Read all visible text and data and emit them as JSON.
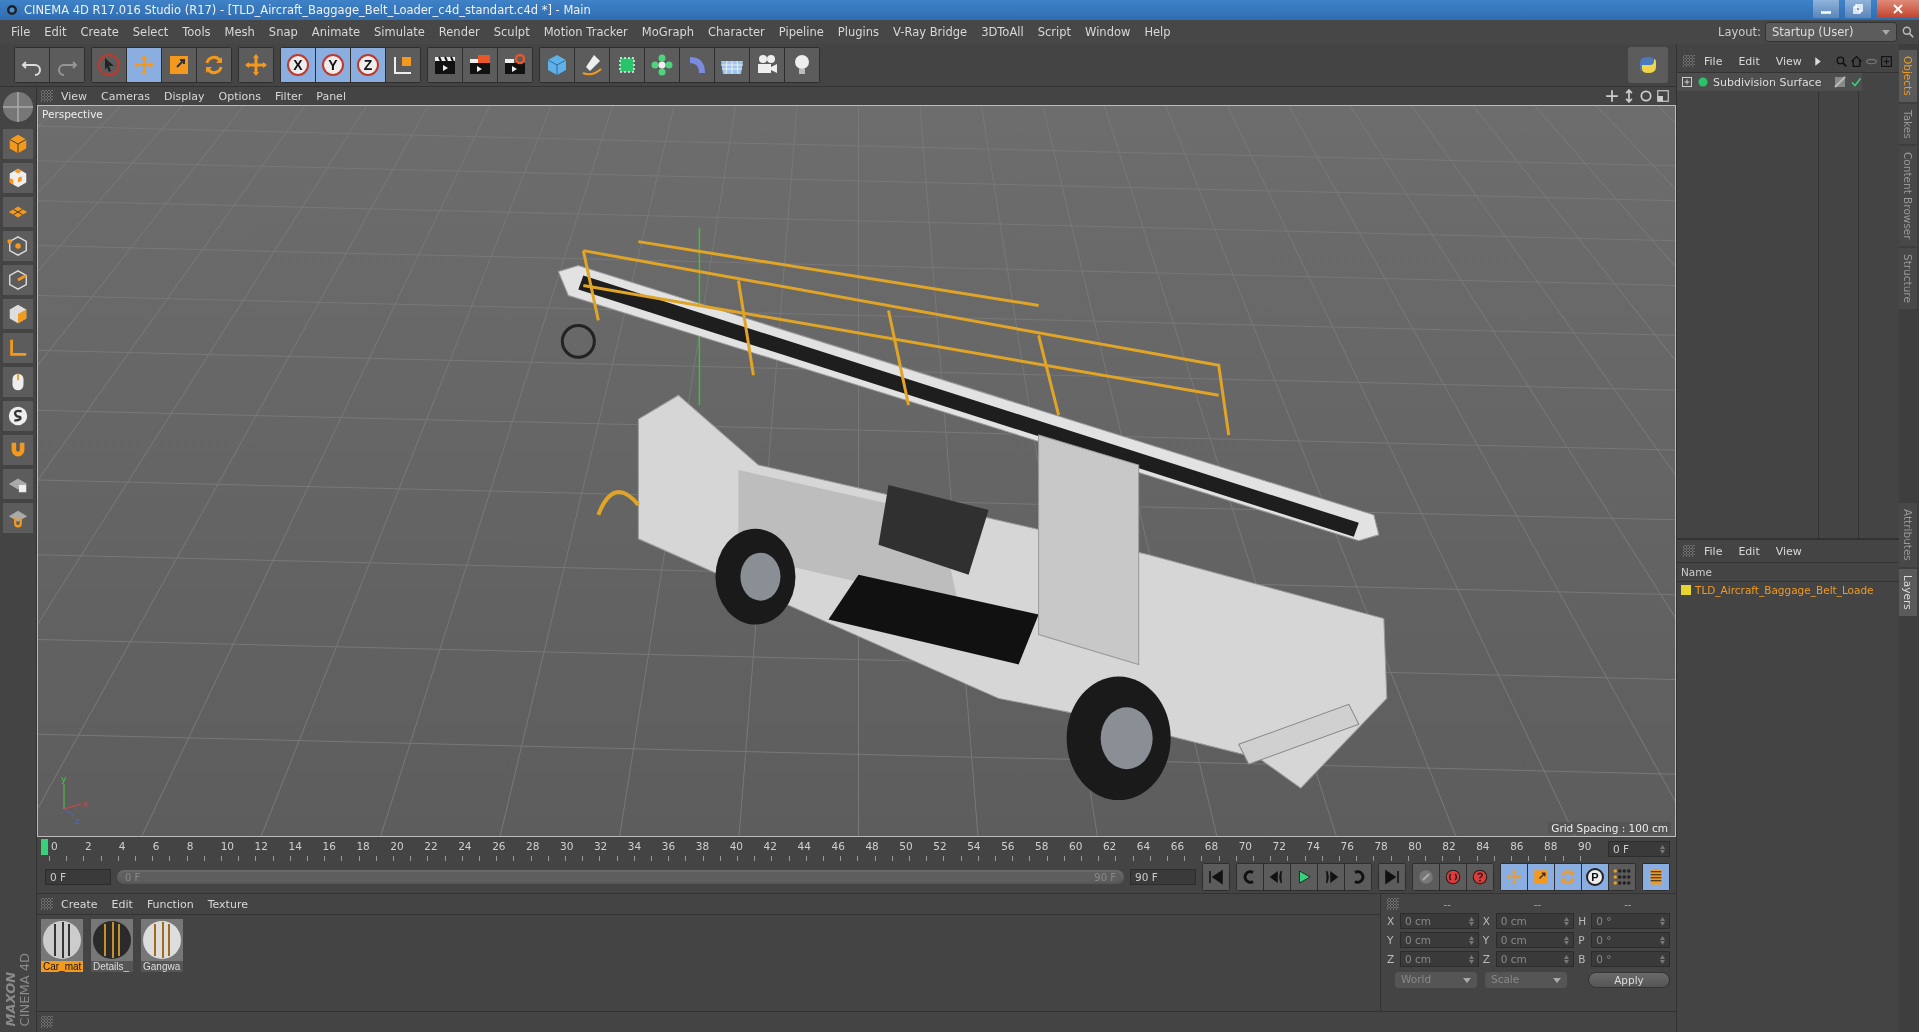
{
  "window": {
    "title": "CINEMA 4D R17.016 Studio (R17) - [TLD_Aircraft_Baggage_Belt_Loader_c4d_standart.c4d *] - Main"
  },
  "menu": [
    "File",
    "Edit",
    "Create",
    "Select",
    "Tools",
    "Mesh",
    "Snap",
    "Animate",
    "Simulate",
    "Render",
    "Sculpt",
    "Motion Tracker",
    "MoGraph",
    "Character",
    "Pipeline",
    "Plugins",
    "V-Ray Bridge",
    "3DToAll",
    "Script",
    "Window",
    "Help"
  ],
  "layout": {
    "label": "Layout:",
    "value": "Startup (User)"
  },
  "toolbar": {
    "tools": [
      {
        "selected": false,
        "disabled": false
      },
      {
        "selected": false,
        "disabled": true
      },
      {
        "selected": false,
        "disabled": false
      },
      {
        "selected": true,
        "disabled": false
      },
      {
        "selected": false,
        "disabled": false
      },
      {
        "selected": false,
        "disabled": false
      },
      {
        "selected": false,
        "disabled": false
      }
    ],
    "axes": [
      {
        "label": "X",
        "selected": true
      },
      {
        "label": "Y",
        "selected": true
      },
      {
        "label": "Z",
        "selected": true
      }
    ]
  },
  "viewport": {
    "menu": [
      "View",
      "Cameras",
      "Display",
      "Options",
      "Filter",
      "Panel"
    ],
    "camera": "Perspective",
    "grid_spacing": "Grid Spacing : 100 cm",
    "axis_labels": [
      "y",
      "x",
      "z"
    ]
  },
  "timeline": {
    "ticks": [
      "0",
      "2",
      "4",
      "6",
      "8",
      "10",
      "12",
      "14",
      "16",
      "18",
      "20",
      "22",
      "24",
      "26",
      "28",
      "30",
      "32",
      "34",
      "36",
      "38",
      "40",
      "42",
      "44",
      "46",
      "48",
      "50",
      "52",
      "54",
      "56",
      "58",
      "60",
      "62",
      "64",
      "66",
      "68",
      "70",
      "72",
      "74",
      "76",
      "78",
      "80",
      "82",
      "84",
      "86",
      "88",
      "90"
    ],
    "current": "0 F",
    "playhead": {
      "level": 0
    }
  },
  "transport": {
    "start": "0 F",
    "range_start": "0 F",
    "range_end": "90 F",
    "end": "90 F",
    "modes": [
      {
        "selected": true
      },
      {
        "selected": true
      },
      {
        "selected": true
      },
      {
        "label": "P",
        "selected": true
      },
      {
        "selected": false
      }
    ],
    "range": {
      "level": 1
    },
    "film_selected": true
  },
  "materials": {
    "menu": [
      "Create",
      "Edit",
      "Function",
      "Texture"
    ],
    "items": [
      {
        "name": "Car_mat",
        "selected": true
      },
      {
        "name": "Details_",
        "selected": false
      },
      {
        "name": "Gangwa",
        "selected": false
      }
    ]
  },
  "coordinates": {
    "headers": [
      "--",
      "--",
      "--"
    ],
    "rows": [
      {
        "axis": "X",
        "position": "0 cm",
        "size_axis": "X",
        "size": "0 cm",
        "rot_axis": "H",
        "rotation": "0 °"
      },
      {
        "axis": "Y",
        "position": "0 cm",
        "size_axis": "Y",
        "size": "0 cm",
        "rot_axis": "P",
        "rotation": "0 °"
      },
      {
        "axis": "Z",
        "position": "0 cm",
        "size_axis": "Z",
        "size": "0 cm",
        "rot_axis": "B",
        "rotation": "0 °"
      }
    ],
    "mode": "World",
    "size_mode": "Scale",
    "apply": "Apply"
  },
  "objects": {
    "menu": [
      "File",
      "Edit",
      "View"
    ],
    "items": [
      {
        "name": "Subdivision Surface",
        "enabled": true
      }
    ]
  },
  "layers": {
    "menu": [
      "File",
      "Edit",
      "View"
    ],
    "column": "Name",
    "items": [
      {
        "name": "TLD_Aircraft_Baggage_Belt_Loade",
        "color": "#e6d62e"
      }
    ]
  },
  "side_tabs_top": [
    {
      "label": "Objects",
      "selected": true
    },
    {
      "label": "Takes",
      "selected": false
    },
    {
      "label": "Content Browser",
      "selected": false
    },
    {
      "label": "Structure",
      "selected": false
    }
  ],
  "side_tabs_bottom": [
    {
      "label": "Attributes",
      "selected": false
    },
    {
      "label": "Layers",
      "selected": true
    }
  ],
  "logo": {
    "brand": "MAXON",
    "product": "CINEMA 4D"
  }
}
